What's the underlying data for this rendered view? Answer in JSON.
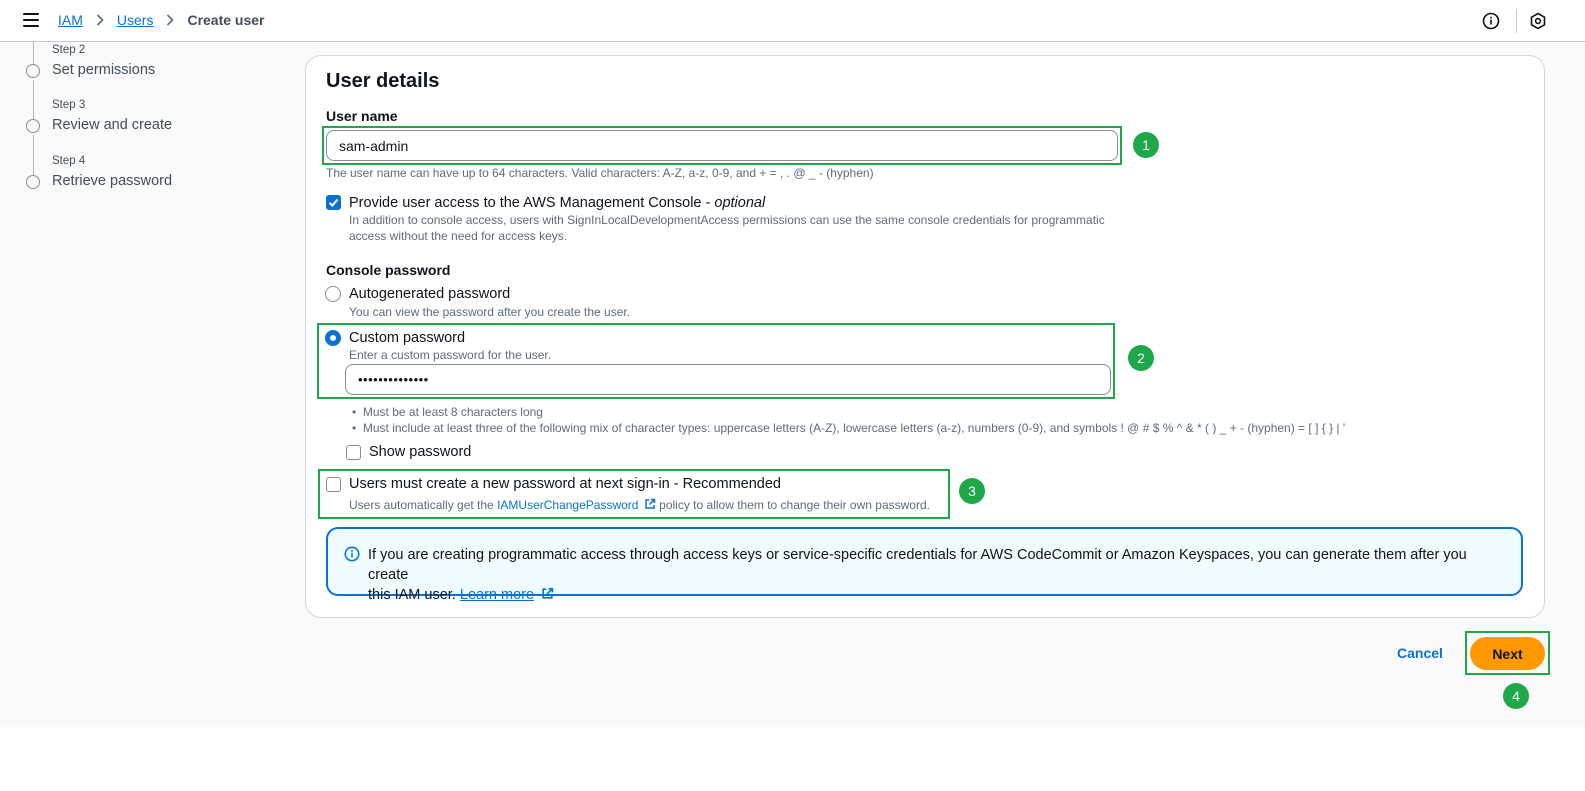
{
  "breadcrumb": {
    "items": [
      "IAM",
      "Users"
    ],
    "current": "Create user"
  },
  "steps": [
    {
      "label": "Step 2",
      "title": "Set permissions"
    },
    {
      "label": "Step 3",
      "title": "Review and create"
    },
    {
      "label": "Step 4",
      "title": "Retrieve password"
    }
  ],
  "user_details": {
    "title": "User details",
    "user_name_label": "User name",
    "user_name_value": "sam-admin",
    "user_name_hint": "The user name can have up to 64 characters. Valid characters: A-Z, a-z, 0-9, and + = , . @ _ - (hyphen)",
    "console_access": {
      "checked": true,
      "label": "Provide user access to the AWS Management Console - ",
      "label_optional": "optional",
      "description_line1": "In addition to console access, users with SignInLocalDevelopmentAccess permissions can use the same console credentials for programmatic",
      "description_line2": "access without the need for access keys."
    },
    "console_password": {
      "label": "Console password",
      "options": [
        {
          "label": "Autogenerated password",
          "hint": "You can view the password after you create the user.",
          "selected": false
        },
        {
          "label": "Custom password",
          "hint": "Enter a custom password for the user.",
          "selected": true
        }
      ],
      "password_value": "••••••••••••••",
      "rules": [
        "Must be at least 8 characters long",
        "Must include at least three of the following mix of character types: uppercase letters (A-Z), lowercase letters (a-z), numbers (0-9), and symbols ! @ # $ % ^ & * ( ) _ + - (hyphen) = [ ] { } | '"
      ],
      "show_password_label": "Show password"
    },
    "reset_password": {
      "checked": false,
      "label": "Users must create a new password at next sign-in - Recommended",
      "hint_before": "Users automatically get the ",
      "hint_link": "IAMUserChangePassword",
      "hint_after": " policy to allow them to change their own password."
    },
    "info_alert": {
      "text_line1": "If you are creating programmatic access through access keys or service-specific credentials for AWS CodeCommit or Amazon Keyspaces, you can generate them after you create",
      "text_line2": "this IAM user. ",
      "link": "Learn more"
    }
  },
  "actions": {
    "cancel": "Cancel",
    "next": "Next"
  },
  "annotations": [
    "1",
    "2",
    "3",
    "4"
  ],
  "colors": {
    "link": "#0972d3",
    "primary_button": "#ff9900",
    "annotation": "#1fa84a"
  }
}
